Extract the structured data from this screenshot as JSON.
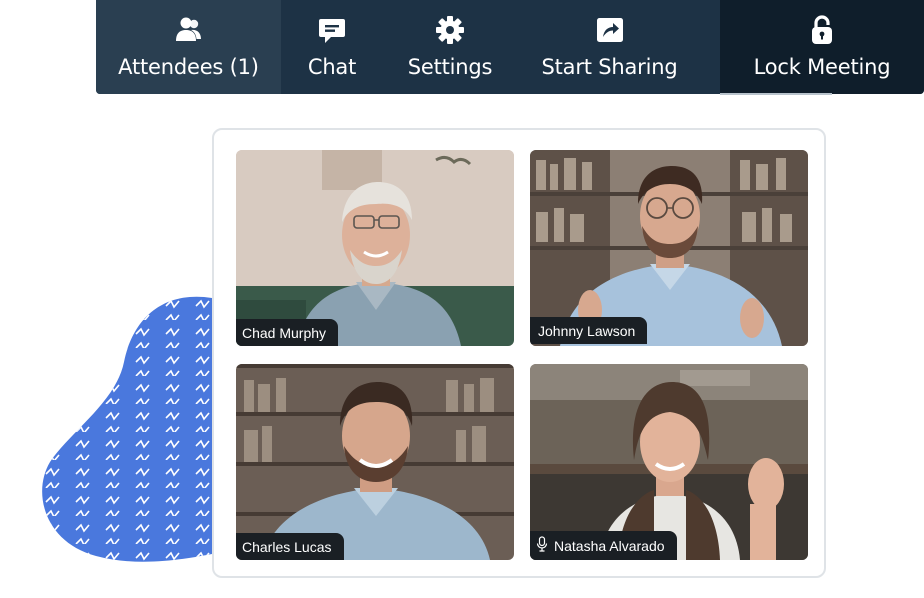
{
  "toolbar": {
    "attendees_label": "Attendees (1)",
    "chat_label": "Chat",
    "settings_label": "Settings",
    "share_label": "Start Sharing",
    "lock_label": "Lock Meeting",
    "icons": {
      "attendees": "users-icon",
      "chat": "chat-bubble-icon",
      "settings": "gear-icon",
      "share": "share-arrow-icon",
      "lock": "lock-icon"
    }
  },
  "participants": [
    {
      "name": "Chad Murphy",
      "muted": false
    },
    {
      "name": "Johnny Lawson",
      "muted": false
    },
    {
      "name": "Charles Lucas",
      "muted": false
    },
    {
      "name": "Natasha Alvarado",
      "muted": false,
      "mic_icon": "microphone-icon"
    }
  ],
  "colors": {
    "toolbar_bg": "#1d3245",
    "toolbar_active": "#2a3f51",
    "toolbar_lock": "#0f1e2b",
    "blob": "#4a78dd",
    "name_tag": "#1a1f24"
  }
}
